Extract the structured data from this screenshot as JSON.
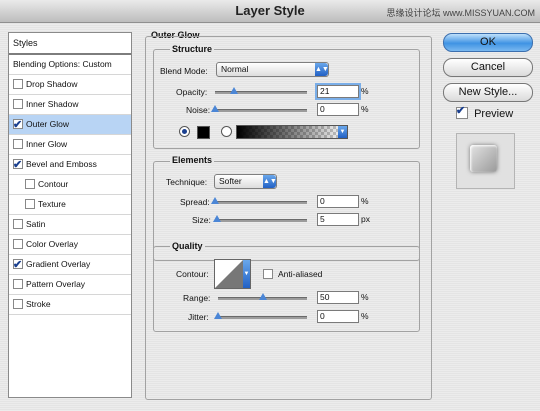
{
  "window": {
    "title": "Layer Style",
    "watermark": "思缘设计论坛 www.MISSYUAN.COM"
  },
  "styles_panel": {
    "header": "Styles",
    "items": [
      {
        "label": "Blending Options: Custom",
        "checkbox": false,
        "checked": false,
        "indent": false,
        "selected": false
      },
      {
        "label": "Drop Shadow",
        "checkbox": true,
        "checked": false,
        "indent": false,
        "selected": false
      },
      {
        "label": "Inner Shadow",
        "checkbox": true,
        "checked": false,
        "indent": false,
        "selected": false
      },
      {
        "label": "Outer Glow",
        "checkbox": true,
        "checked": true,
        "indent": false,
        "selected": true
      },
      {
        "label": "Inner Glow",
        "checkbox": true,
        "checked": false,
        "indent": false,
        "selected": false
      },
      {
        "label": "Bevel and Emboss",
        "checkbox": true,
        "checked": true,
        "indent": false,
        "selected": false
      },
      {
        "label": "Contour",
        "checkbox": true,
        "checked": false,
        "indent": true,
        "selected": false
      },
      {
        "label": "Texture",
        "checkbox": true,
        "checked": false,
        "indent": true,
        "selected": false
      },
      {
        "label": "Satin",
        "checkbox": true,
        "checked": false,
        "indent": false,
        "selected": false
      },
      {
        "label": "Color Overlay",
        "checkbox": true,
        "checked": false,
        "indent": false,
        "selected": false
      },
      {
        "label": "Gradient Overlay",
        "checkbox": true,
        "checked": true,
        "indent": false,
        "selected": false
      },
      {
        "label": "Pattern Overlay",
        "checkbox": true,
        "checked": false,
        "indent": false,
        "selected": false
      },
      {
        "label": "Stroke",
        "checkbox": true,
        "checked": false,
        "indent": false,
        "selected": false
      }
    ]
  },
  "outer_glow": {
    "title": "Outer Glow",
    "structure": {
      "title": "Structure",
      "blend_mode_label": "Blend Mode:",
      "blend_mode_value": "Normal",
      "opacity_label": "Opacity:",
      "opacity_value": "21",
      "opacity_unit": "%",
      "opacity_fraction": 0.21,
      "noise_label": "Noise:",
      "noise_value": "0",
      "noise_unit": "%",
      "noise_fraction": 0,
      "color_mode": "solid",
      "glow_color": "#000000"
    },
    "elements": {
      "title": "Elements",
      "technique_label": "Technique:",
      "technique_value": "Softer",
      "spread_label": "Spread:",
      "spread_value": "0",
      "spread_unit": "%",
      "spread_fraction": 0,
      "size_label": "Size:",
      "size_value": "5",
      "size_unit": "px",
      "size_fraction": 0.02
    },
    "quality": {
      "title": "Quality",
      "contour_label": "Contour:",
      "anti_aliased_label": "Anti-aliased",
      "anti_aliased_checked": false,
      "range_label": "Range:",
      "range_value": "50",
      "range_unit": "%",
      "range_fraction": 0.5,
      "jitter_label": "Jitter:",
      "jitter_value": "0",
      "jitter_unit": "%",
      "jitter_fraction": 0
    }
  },
  "buttons": {
    "ok": "OK",
    "cancel": "Cancel",
    "new_style": "New Style..."
  },
  "preview": {
    "label": "Preview",
    "checked": true
  }
}
